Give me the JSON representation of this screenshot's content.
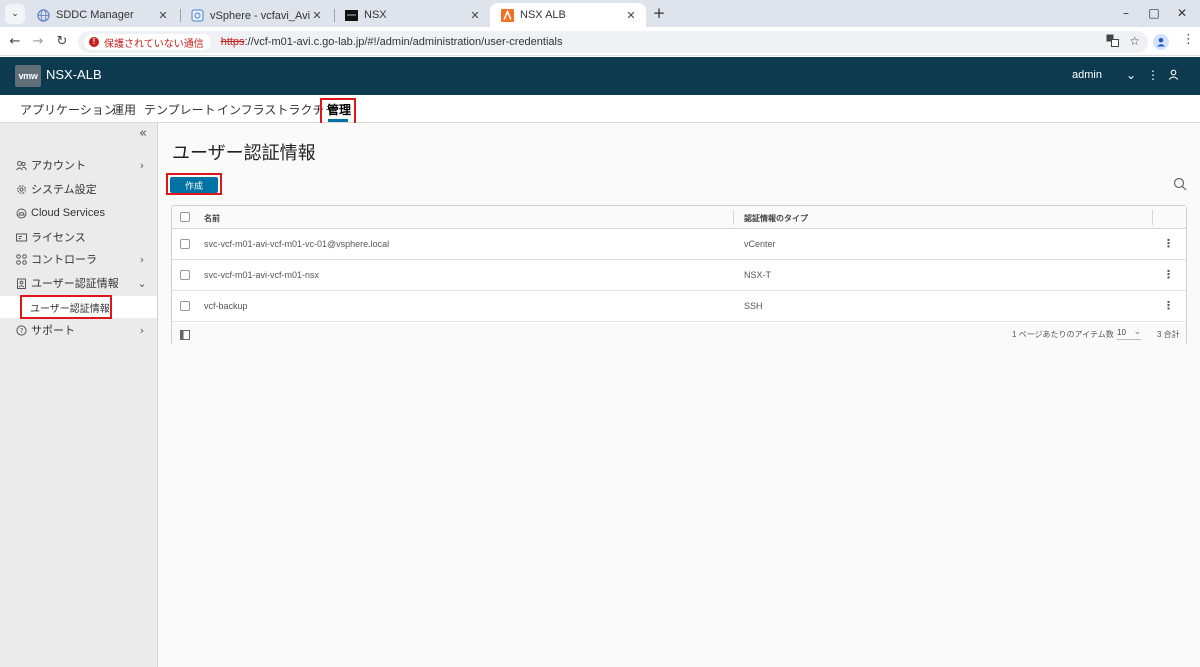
{
  "browser": {
    "tabs": [
      {
        "title": "SDDC Manager",
        "favicon": "vmware-globe-icon",
        "active": false
      },
      {
        "title": "vSphere - vcfavi_Avi-se-jjiso - サ",
        "favicon": "vsphere-icon",
        "active": false
      },
      {
        "title": "NSX",
        "favicon": "nsx-icon",
        "active": false
      },
      {
        "title": "NSX ALB",
        "favicon": "nsx-alb-icon",
        "active": true
      }
    ],
    "new_tab_symbol": "+",
    "window_controls": {
      "minimize": "–",
      "maximize": "□",
      "close": "✕"
    },
    "security_label": "保護されていない通信",
    "url_scheme": "https",
    "url_rest": "://vcf-m01-avi.c.go-lab.jp/#!/admin/administration/user-credentials"
  },
  "app": {
    "logo": "vmw",
    "title": "NSX-ALB",
    "user": "admin"
  },
  "main_nav": {
    "items": [
      "アプリケーション",
      "運用",
      "テンプレート",
      "インフラストラクチャ",
      "管理"
    ],
    "active_index": 4
  },
  "sidebar": {
    "collapse_symbol": "«",
    "items": [
      {
        "label": "アカウント",
        "icon": "users-icon",
        "arrow": "›"
      },
      {
        "label": "システム設定",
        "icon": "gear-icon",
        "arrow": ""
      },
      {
        "label": "Cloud Services",
        "icon": "cloud-icon",
        "arrow": ""
      },
      {
        "label": "ライセンス",
        "icon": "license-icon",
        "arrow": ""
      },
      {
        "label": "コントローラ",
        "icon": "controller-icon",
        "arrow": "›"
      },
      {
        "label": "ユーザー認証情報",
        "icon": "credentials-icon",
        "arrow": "⌄"
      },
      {
        "label": "サポート",
        "icon": "help-icon",
        "arrow": "›"
      }
    ],
    "subitem": "ユーザー認証情報"
  },
  "page": {
    "title": "ユーザー認証情報",
    "create_button": "作成"
  },
  "table": {
    "columns": [
      "名前",
      "認証情報のタイプ"
    ],
    "rows": [
      {
        "name": "svc-vcf-m01-avi-vcf-m01-vc-01@vsphere.local",
        "type": "vCenter"
      },
      {
        "name": "svc-vcf-m01-avi-vcf-m01-nsx",
        "type": "NSX-T"
      },
      {
        "name": "vcf-backup",
        "type": "SSH"
      }
    ],
    "footer": {
      "per_page_label": "1 ページあたりのアイテム数",
      "per_page_value": "10",
      "total": "3 合計"
    }
  },
  "colors": {
    "header_bg": "#0e3a4f",
    "accent": "#0072a3",
    "highlight_red": "#e0161d"
  }
}
